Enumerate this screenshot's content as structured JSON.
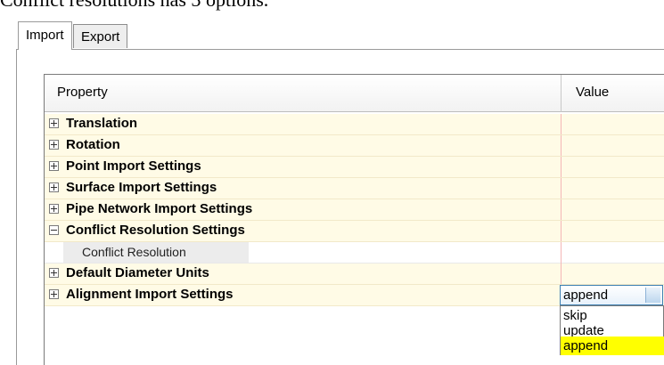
{
  "caption": "Conflict resolutions has 3 options.",
  "tabs": [
    {
      "label": "Import",
      "active": true
    },
    {
      "label": "Export",
      "active": false
    }
  ],
  "grid": {
    "header": {
      "property": "Property",
      "value": "Value"
    },
    "rows": [
      {
        "label": "Translation",
        "expanded": false
      },
      {
        "label": "Rotation",
        "expanded": false
      },
      {
        "label": "Point Import Settings",
        "expanded": false
      },
      {
        "label": "Surface Import Settings",
        "expanded": false
      },
      {
        "label": "Pipe Network Import Settings",
        "expanded": false
      },
      {
        "label": "Conflict Resolution Settings",
        "expanded": true
      },
      {
        "label": "Default Diameter Units",
        "expanded": false
      },
      {
        "label": "Alignment Import Settings",
        "expanded": false
      }
    ],
    "subrow": {
      "label": "Conflict Resolution",
      "value": "append"
    }
  },
  "dropdown": {
    "options": [
      "skip",
      "update",
      "append"
    ],
    "selected": "append"
  },
  "colors": {
    "category_row_bg": "#fffbe6",
    "highlight": "#ffff00",
    "combo_border": "#3c7fb1"
  }
}
